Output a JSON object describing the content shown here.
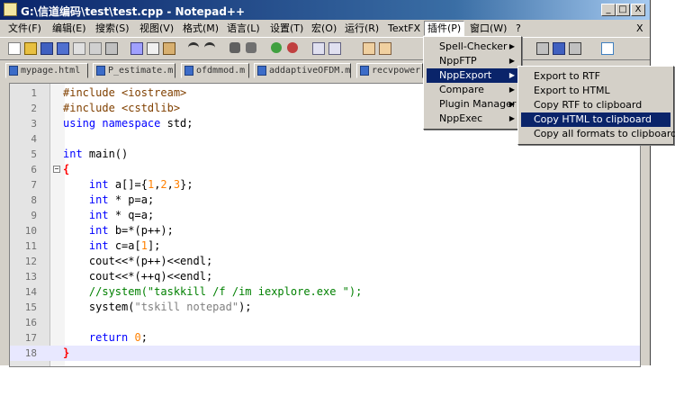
{
  "window": {
    "title": "G:\\信道编码\\test\\test.cpp - Notepad++"
  },
  "title_buttons": {
    "minimize": "_",
    "maximize": "□",
    "close": "X"
  },
  "menu": {
    "items": [
      "文件(F)",
      "编辑(E)",
      "搜索(S)",
      "视图(V)",
      "格式(M)",
      "语言(L)",
      "设置(T)",
      "宏(O)",
      "运行(R)",
      "TextFX",
      "插件(P)",
      "窗口(W)",
      "?"
    ],
    "close_doc": "X"
  },
  "tabs": [
    "mypage.html",
    "P_estimate.m",
    "ofdmmod.m",
    "addaptiveOFDM.m",
    "recvpower"
  ],
  "code_lines": [
    {
      "num": "1"
    },
    {
      "num": "2"
    },
    {
      "num": "3"
    },
    {
      "num": "4"
    },
    {
      "num": "5"
    },
    {
      "num": "6"
    },
    {
      "num": "7"
    },
    {
      "num": "8"
    },
    {
      "num": "9"
    },
    {
      "num": "10"
    },
    {
      "num": "11"
    },
    {
      "num": "12"
    },
    {
      "num": "13"
    },
    {
      "num": "14"
    },
    {
      "num": "15"
    },
    {
      "num": "16"
    },
    {
      "num": "17"
    },
    {
      "num": "18"
    }
  ],
  "code": {
    "l1a": "#include ",
    "l1b": "<iostream>",
    "l2a": "#include ",
    "l2b": "<cstdlib>",
    "l3a": "using namespace",
    "l3b": " std;",
    "l5a": "int",
    "l5b": " main()",
    "l6": "{",
    "l7a": "int",
    "l7b": " a[]={",
    "l7c": "1",
    "l7d": ",",
    "l7e": "2",
    "l7f": ",",
    "l7g": "3",
    "l7h": "};",
    "l8a": "int",
    "l8b": " * p=a;",
    "l9a": "int",
    "l9b": " * q=a;",
    "l10a": "int",
    "l10b": " b=*(p++);",
    "l11a": "int",
    "l11b": " c=a[",
    "l11c": "1",
    "l11d": "];",
    "l12": "cout<<*(p++)<<endl;",
    "l13": "cout<<*(++q)<<endl;",
    "l14": "//system(\"taskkill /f /im iexplore.exe \");",
    "l15a": "system(",
    "l15b": "\"tskill notepad\"",
    "l15c": ");",
    "l17a": "return",
    "l17b": " 0",
    "l17c": ";",
    "l18": "}"
  },
  "plugins_menu": {
    "items": [
      {
        "label": "Spell-Checker"
      },
      {
        "label": "NppFTP"
      },
      {
        "label": "NppExport"
      },
      {
        "label": "Compare"
      },
      {
        "label": "Plugin Manager"
      },
      {
        "label": "NppExec"
      }
    ]
  },
  "nppexport_menu": {
    "items": [
      {
        "label": "Export to RTF"
      },
      {
        "label": "Export to HTML"
      },
      {
        "label": "Copy RTF to clipboard"
      },
      {
        "label": "Copy HTML to clipboard"
      },
      {
        "label": "Copy all formats to clipboard"
      }
    ]
  },
  "colors": {
    "selection": "#0a246a",
    "keyword": "#0000ff",
    "number": "#ff8000",
    "comment": "#008000"
  }
}
